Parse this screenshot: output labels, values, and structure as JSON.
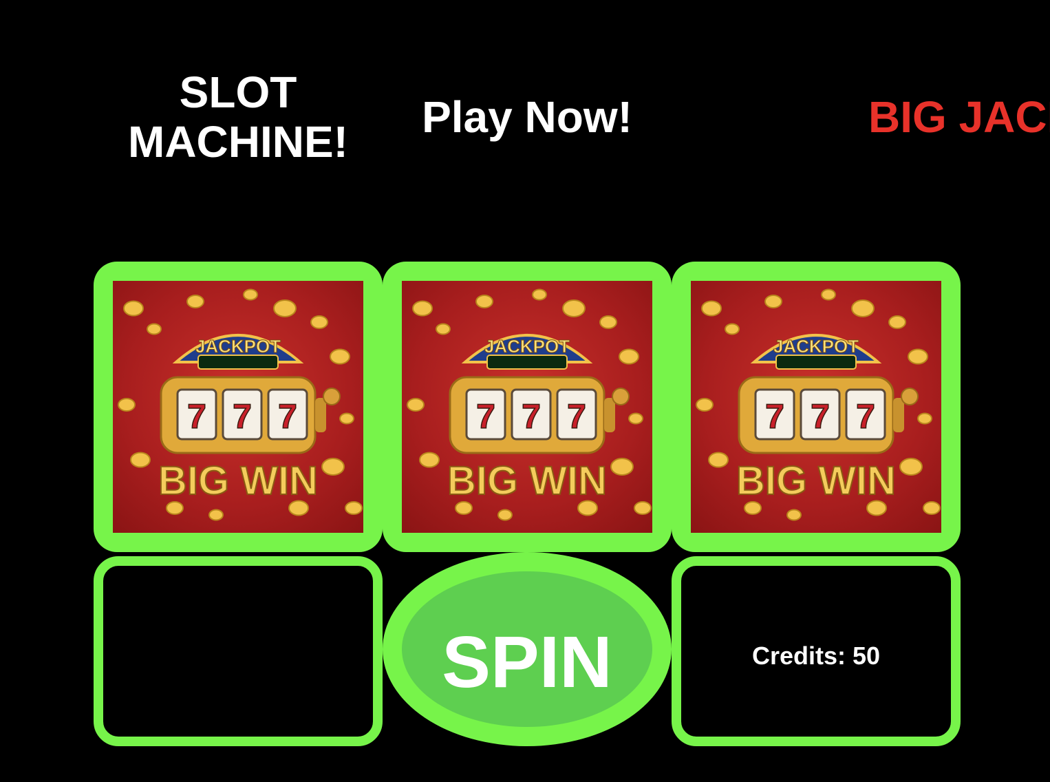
{
  "header": {
    "title": "SLOT MACHINE!",
    "subtitle": "Play Now!",
    "marquee": "BIG JACKPOT"
  },
  "reels": [
    {
      "top_label": "JACKPOT",
      "symbols": [
        "7",
        "7",
        "7"
      ],
      "bottom_label": "BIG WIN"
    },
    {
      "top_label": "JACKPOT",
      "symbols": [
        "7",
        "7",
        "7"
      ],
      "bottom_label": "BIG WIN"
    },
    {
      "top_label": "JACKPOT",
      "symbols": [
        "7",
        "7",
        "7"
      ],
      "bottom_label": "BIG WIN"
    }
  ],
  "controls": {
    "spin_label": "SPIN",
    "credits_text": "Credits: 50"
  },
  "colors": {
    "background": "#000000",
    "frame_green": "#77f44a",
    "spin_inner_green": "#5ecf50",
    "marquee_red": "#e8322a",
    "text_white": "#ffffff"
  },
  "icons": {
    "reel_image": "jackpot-slot-machine-icon"
  }
}
